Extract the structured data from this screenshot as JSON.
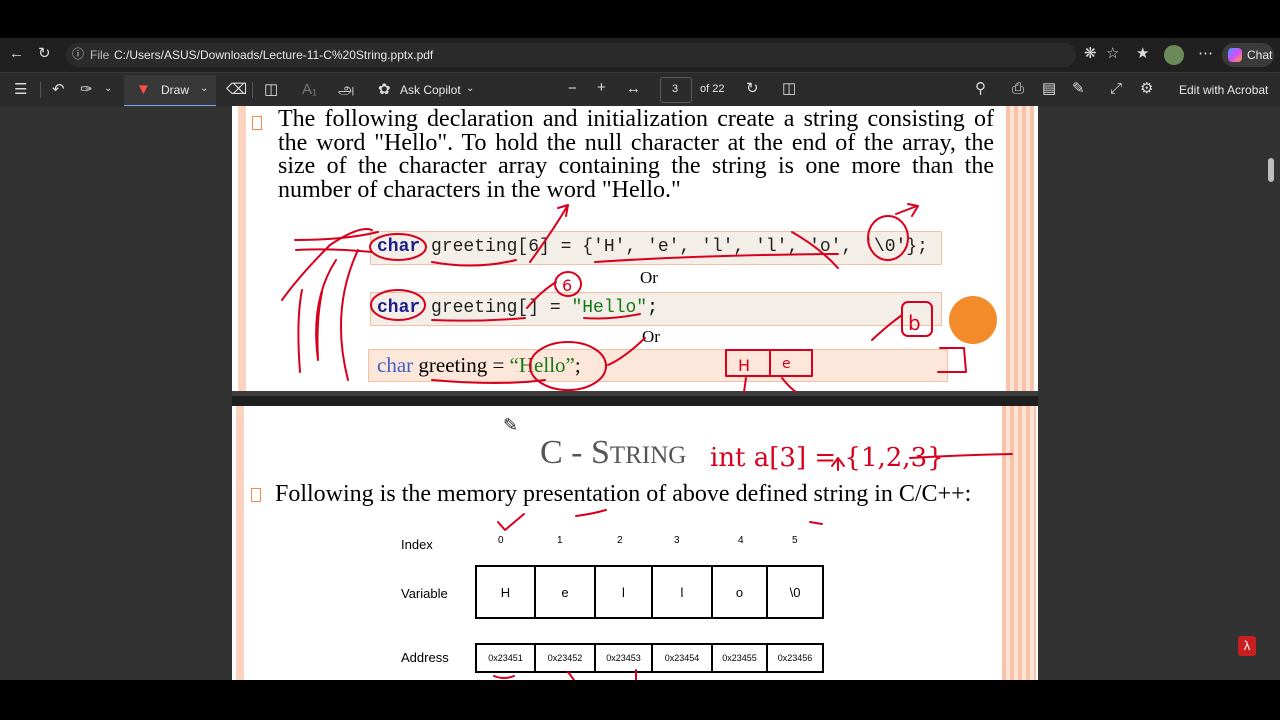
{
  "browser": {
    "file_label": "File",
    "url": "C:/Users/ASUS/Downloads/Lecture-11-C%20String.pptx.pdf",
    "chat_label": "Chat"
  },
  "pdf_toolbar": {
    "draw_label": "Draw",
    "copilot_label": "Ask Copilot",
    "page_current": "3",
    "page_total": "of 22",
    "acrobat_label": "Edit with Acrobat"
  },
  "slide1": {
    "bullet": "The following declaration and initialization create a string consisting of the word \"Hello\". To hold the null character at the end of the array, the size of the character array containing the string is one more than the number of characters in the word \"Hello.\"",
    "code1": {
      "kw": "char",
      "rest": " greeting[6] = {'H', 'e', 'l', 'l', 'o', '\\0'};"
    },
    "or1": "Or",
    "code2": {
      "kw": "char",
      "mid": " greeting[] = ",
      "str": "\"Hello\"",
      "end": ";"
    },
    "or2": "Or",
    "code3": {
      "kw": "char",
      "mid": " greeting = ",
      "str": "“Hello”",
      "end": ";"
    }
  },
  "slide2": {
    "title_prefix": "C - S",
    "title_rest": "TRING",
    "bullet": "Following is the memory presentation of above defined string in C/C++:",
    "row_labels": {
      "index": "Index",
      "variable": "Variable",
      "address": "Address"
    },
    "indices": [
      "0",
      "1",
      "2",
      "3",
      "4",
      "5"
    ],
    "values": [
      "H",
      "e",
      "l",
      "l",
      "o",
      "\\0"
    ],
    "addresses": [
      "0x23451",
      "0x23452",
      "0x23453",
      "0x23454",
      "0x23455",
      "0x23456"
    ]
  },
  "annotations": {
    "ink_color": "#d8001c",
    "handwritten_expr": "int a[3] = {1,2,3}",
    "handwritten_boxes": [
      "H",
      "e"
    ]
  },
  "colors": {
    "accent_orange": "#f48b4a",
    "keyword_blue": "#1c1c8c",
    "string_green": "#147814",
    "slide_border": "#f8c8b0"
  }
}
